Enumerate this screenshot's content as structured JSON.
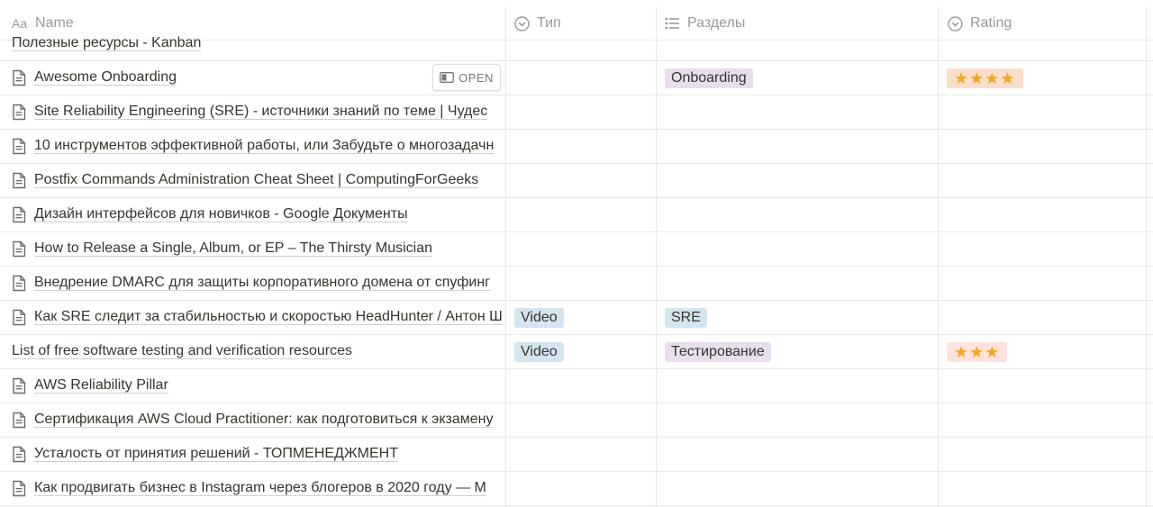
{
  "columns": {
    "name": {
      "label": "Name",
      "icon": "text-type-icon"
    },
    "type": {
      "label": "Тип",
      "icon": "select-icon"
    },
    "sections": {
      "label": "Разделы",
      "icon": "multi-select-icon"
    },
    "rating": {
      "label": "Rating",
      "icon": "select-icon"
    }
  },
  "open_button_label": "OPEN",
  "rows": [
    {
      "name": "Полезные ресурсы - Kanban"
    },
    {
      "name": "Awesome Onboarding",
      "section": "Onboarding",
      "rating": "★★★★"
    },
    {
      "name": "Site Reliability Engineering (SRE) - источники знаний по теме | Чудес"
    },
    {
      "name": "10 инструментов эффективной работы, или Забудьте о многозадачн"
    },
    {
      "name": "Postfix Commands Administration Cheat Sheet | ComputingForGeeks"
    },
    {
      "name": "Дизайн интерфейсов для новичков - Google Документы"
    },
    {
      "name": "How to Release a Single, Album, or EP – The Thirsty Musician"
    },
    {
      "name": "Внедрение DMARC для защиты корпоративного домена от спуфинг"
    },
    {
      "name": "Как SRE следит за стабильностью и скоростью HeadHunter / Антон Ш",
      "type": "Video",
      "section": "SRE"
    },
    {
      "name": "List of free software testing and verification resources",
      "type": "Video",
      "section": "Тестирование",
      "rating": "★★★"
    },
    {
      "name": "AWS Reliability Pillar"
    },
    {
      "name": "Сертификация AWS Cloud Practitioner: как подготовиться к экзамену"
    },
    {
      "name": "Усталость от принятия решений - ТОПМЕНЕДЖМЕНТ"
    },
    {
      "name": "Как продвигать бизнес в Instagram через блогеров в 2020 году — M"
    }
  ],
  "colors": {
    "type_tag": "#d3e5ef",
    "section_tag": "#e8deee",
    "rating_4": "#fadec9",
    "rating_3": "#ffe2dd",
    "star": "#f5a623"
  }
}
